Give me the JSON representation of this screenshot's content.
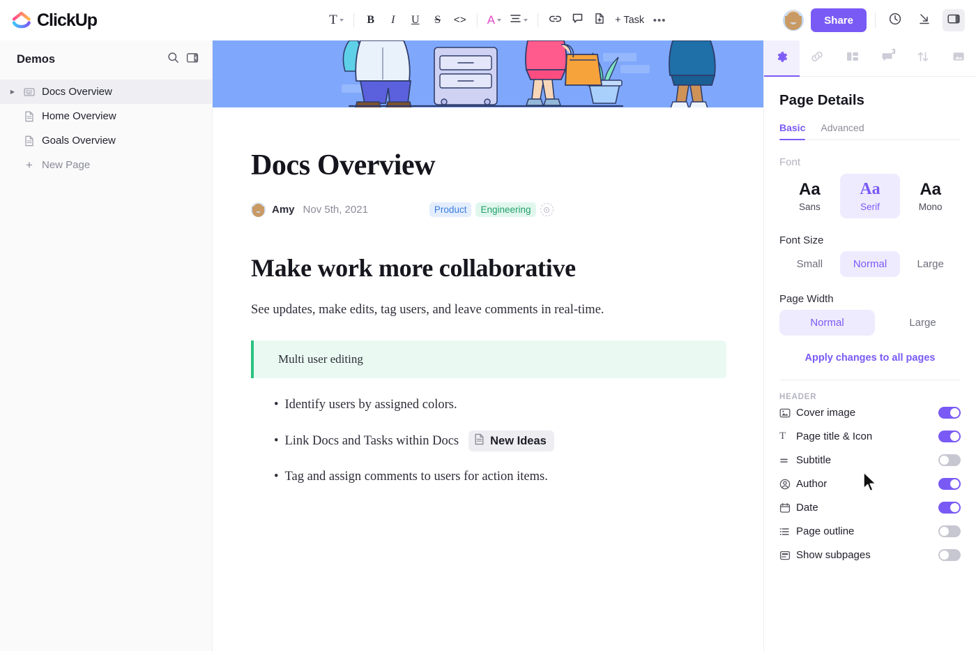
{
  "brand": {
    "name": "ClickUp",
    "accent": "#7a5af5"
  },
  "toolbar": {
    "items": [
      {
        "name": "text-style",
        "glyph": "T",
        "caret": true
      },
      {
        "name": "bold",
        "glyph": "B"
      },
      {
        "name": "italic",
        "glyph": "I"
      },
      {
        "name": "underline",
        "glyph": "U"
      },
      {
        "name": "strikethrough",
        "glyph": "S"
      },
      {
        "name": "code",
        "glyph": "<>"
      },
      {
        "name": "text-color",
        "glyph": "A",
        "caret": true,
        "color": "#e248c8"
      },
      {
        "name": "align",
        "glyph": "align",
        "caret": true
      },
      {
        "name": "link",
        "glyph": "link"
      },
      {
        "name": "comment",
        "glyph": "comment"
      },
      {
        "name": "page",
        "glyph": "page"
      }
    ],
    "add_task_label": "+ Task",
    "more_label": "•••"
  },
  "topright": {
    "share_label": "Share",
    "icons": [
      "history-icon",
      "import-icon",
      "panel-toggle-icon"
    ]
  },
  "sidebar": {
    "title": "Demos",
    "search_icon": "search-icon",
    "collapse_icon": "collapse-sidebar-icon",
    "items": [
      {
        "label": "Docs Overview",
        "icon": "doc-book-icon",
        "selected": true,
        "expandable": true
      },
      {
        "label": "Home Overview",
        "icon": "doc-page-icon",
        "selected": false,
        "expandable": false
      },
      {
        "label": "Goals Overview",
        "icon": "doc-page-icon",
        "selected": false,
        "expandable": false
      }
    ],
    "new_page_label": "New Page"
  },
  "doc": {
    "cover_color": "#7fa8fc",
    "title": "Docs Overview",
    "author": "Amy",
    "date": "Nov 5th, 2021",
    "tags": [
      {
        "label": "Product",
        "color": "#3b7de0",
        "bg": "#e3edfc"
      },
      {
        "label": "Engineering",
        "color": "#22a06b",
        "bg": "#e1f7ee"
      }
    ],
    "heading": "Make work more collaborative",
    "paragraph": "See updates, make edits, tag users, and leave comments in real-time.",
    "callout": {
      "text": "Multi user editing",
      "border": "#27c281",
      "bg": "#eafaf2"
    },
    "bullets": [
      {
        "text": "Identify users by assigned colors.",
        "chip": null
      },
      {
        "text": "Link Docs and Tasks within Docs",
        "chip": "New Ideas"
      },
      {
        "text": "Tag and assign comments to users for action items.",
        "chip": null
      }
    ]
  },
  "panel": {
    "tabs": [
      {
        "name": "settings",
        "icon": "gear-icon",
        "active": true,
        "badge": null
      },
      {
        "name": "relationships",
        "icon": "link-icon",
        "active": false,
        "badge": null
      },
      {
        "name": "layout",
        "icon": "layout-icon",
        "active": false,
        "badge": null
      },
      {
        "name": "comments",
        "icon": "comment-icon",
        "active": false,
        "badge": "3"
      },
      {
        "name": "sort",
        "icon": "sort-icon",
        "active": false,
        "badge": null
      },
      {
        "name": "cover",
        "icon": "image-icon",
        "active": false,
        "badge": null
      }
    ],
    "title": "Page Details",
    "subtabs": [
      {
        "label": "Basic",
        "active": true
      },
      {
        "label": "Advanced",
        "active": false
      }
    ],
    "font_label": "Font",
    "fonts": [
      {
        "sample": "Aa",
        "name": "Sans",
        "selected": false
      },
      {
        "sample": "Aa",
        "name": "Serif",
        "selected": true
      },
      {
        "sample": "Aa",
        "name": "Mono",
        "selected": false
      }
    ],
    "font_size_label": "Font Size",
    "font_sizes": [
      {
        "label": "Small",
        "selected": false
      },
      {
        "label": "Normal",
        "selected": true
      },
      {
        "label": "Large",
        "selected": false
      }
    ],
    "page_width_label": "Page Width",
    "page_widths": [
      {
        "label": "Normal",
        "selected": true
      },
      {
        "label": "Large",
        "selected": false
      }
    ],
    "apply_label": "Apply changes to all pages",
    "header_label": "HEADER",
    "header_toggles": [
      {
        "label": "Cover image",
        "icon": "image-icon",
        "on": true
      },
      {
        "label": "Page title & Icon",
        "icon": "text-icon",
        "on": true
      },
      {
        "label": "Subtitle",
        "icon": "subtitle-icon",
        "on": false
      },
      {
        "label": "Author",
        "icon": "user-icon",
        "on": true
      },
      {
        "label": "Date",
        "icon": "calendar-icon",
        "on": true
      },
      {
        "label": "Page outline",
        "icon": "list-icon",
        "on": false
      },
      {
        "label": "Show subpages",
        "icon": "subpages-icon",
        "on": false
      }
    ]
  }
}
